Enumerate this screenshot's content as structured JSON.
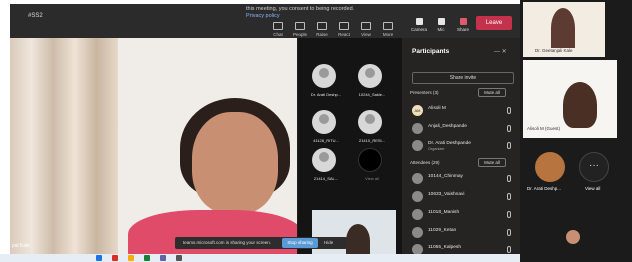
{
  "meeting": {
    "title": "#SS2",
    "recording_notice": "this meeting, you consent to being recorded.",
    "privacy_link": "Privacy policy",
    "toolbar": [
      "Chat",
      "People",
      "Raise",
      "React",
      "View",
      "More"
    ],
    "actions": [
      "Camera",
      "Mic",
      "Share"
    ],
    "leave_label": "Leave"
  },
  "main_video": {
    "speaker_name": "pal Kale"
  },
  "grid": {
    "tiles": [
      {
        "label": "Dr. Arati Deshp..."
      },
      {
        "label": "10244_Sakle..."
      },
      {
        "label": "41128_RITU..."
      },
      {
        "label": "21410_RESI..."
      },
      {
        "label": "21414_SAL..."
      },
      {
        "label": "View all"
      }
    ]
  },
  "share_bar": {
    "message": "teams.microsoft.com is sharing your screen.",
    "stop_label": "Stop sharing",
    "hide_label": "Hide"
  },
  "participants": {
    "title": "Participants",
    "share_invite": "Share invite",
    "presenters_label": "Presenters (3)",
    "attendees_label": "Attendees (29)",
    "mute_all": "Mute all",
    "presenters": [
      {
        "initials": "AM",
        "name": "Alisoli M",
        "sub": ""
      },
      {
        "initials": "",
        "name": "Anjali_Deshpande",
        "sub": ""
      },
      {
        "initials": "",
        "name": "Dr. Arati Deshpande",
        "sub": "Organizer"
      }
    ],
    "attendees": [
      {
        "name": "10144_Chinmay"
      },
      {
        "name": "10633_Vaishnavi"
      },
      {
        "name": "11018_Manish"
      },
      {
        "name": "11029_Ketan"
      },
      {
        "name": "11055_Kalpesh"
      }
    ]
  },
  "sidebar": {
    "tile1_name": "Dr. Geetanjali Kale",
    "tile2_name": "Alisoli M (Guest)",
    "avatar_name": "Dr. Arati Deshp...",
    "view_all": "View all"
  },
  "colors": {
    "leave": "#c4314b",
    "stop_sharing": "#5b9bd5",
    "panel_bg": "#252423"
  }
}
